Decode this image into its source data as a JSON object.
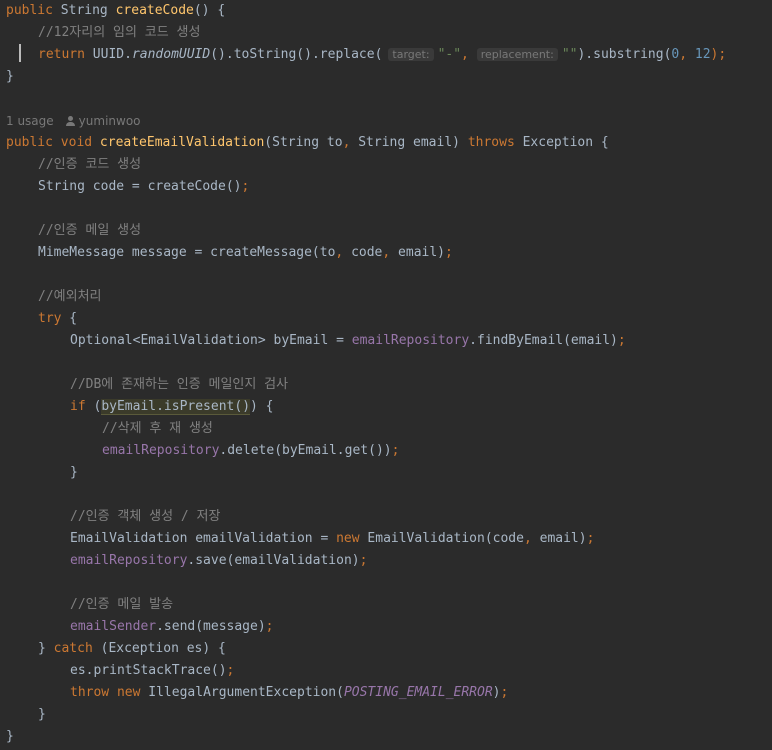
{
  "code": {
    "l1": {
      "t1": "public",
      "t2": " String ",
      "t3": "createCode",
      "t4": "() {"
    },
    "l2": {
      "comment": "//12자리의 임의 코드 생성"
    },
    "l3": {
      "kw_return": "return",
      "uuid": " UUID.",
      "random": "randomUUID",
      "mid": "().toString().replace(",
      "hint_target": "target:",
      "str_dash": "\"-\"",
      "comma": ", ",
      "hint_replacement": "replacement:",
      "str_empty": "\"\"",
      "sub": ").substring(",
      "n0": "0",
      "comma2": ", ",
      "n12": "12",
      "end": ");"
    },
    "l4": {
      "brace": "}"
    },
    "meta": {
      "usage": "1 usage",
      "author": "yuminwoo"
    },
    "l6": {
      "t1": "public void",
      "t2": "createEmailValidation",
      "t3": "(String to",
      "t4": ", ",
      "t5": "String email) ",
      "t6": "throws",
      "t7": " Exception {"
    },
    "l7": {
      "comment": "//인증 코드 생성"
    },
    "l8": {
      "t1": "String code = createCode()",
      "t2": ";"
    },
    "l10": {
      "comment": "//인증 메일 생성"
    },
    "l11": {
      "t1": "MimeMessage message = createMessage(to",
      "t2": ", ",
      "t3": "code",
      "t4": ", ",
      "t5": "email)",
      "t6": ";"
    },
    "l13": {
      "comment": "//예외처리"
    },
    "l14": {
      "kw": "try",
      "t2": " {"
    },
    "l15": {
      "t1": "Optional<EmailValidation> byEmail = ",
      "fld": "emailRepository",
      "t3": ".findByEmail(email)",
      "t4": ";"
    },
    "l17": {
      "comment": "//DB에 존재하는 인증 메일인지 검사"
    },
    "l18": {
      "kw": "if",
      "t2": " (",
      "hl": "byEmail.isPresent()",
      "t3": ") {"
    },
    "l19": {
      "comment": "//삭제 후 재 생성"
    },
    "l20": {
      "fld": "emailRepository",
      "t2": ".delete(byEmail.get())",
      "t3": ";"
    },
    "l21": {
      "brace": "}"
    },
    "l23": {
      "comment": "//인증 객체 생성 / 저장"
    },
    "l24": {
      "t1": "EmailValidation emailValidation = ",
      "kw": "new",
      "t3": " EmailValidation(code",
      "t4": ", ",
      "t5": "email)",
      "t6": ";"
    },
    "l25": {
      "fld": "emailRepository",
      "t2": ".save(emailValidation)",
      "t3": ";"
    },
    "l27": {
      "comment": "//인증 메일 발송"
    },
    "l28": {
      "fld": "emailSender",
      "t2": ".send(message)",
      "t3": ";"
    },
    "l29": {
      "t1": "} ",
      "kw": "catch",
      "t3": " (Exception es) {"
    },
    "l30": {
      "t1": "es.printStackTrace()",
      "t2": ";"
    },
    "l31": {
      "kw1": "throw",
      "sp": " ",
      "kw2": "new",
      "t3": " IllegalArgumentException(",
      "const": "POSTING_EMAIL_ERROR",
      "t5": ")",
      "t6": ";"
    },
    "l32": {
      "brace": "}"
    },
    "l33": {
      "brace": "}"
    }
  },
  "colors": {
    "background": "#2b2b2b",
    "keyword": "#cc7832",
    "function": "#ffc66d",
    "comment": "#808080",
    "string": "#6a8759",
    "number": "#6897bb",
    "field": "#9876aa",
    "plain": "#a9b7c6"
  }
}
